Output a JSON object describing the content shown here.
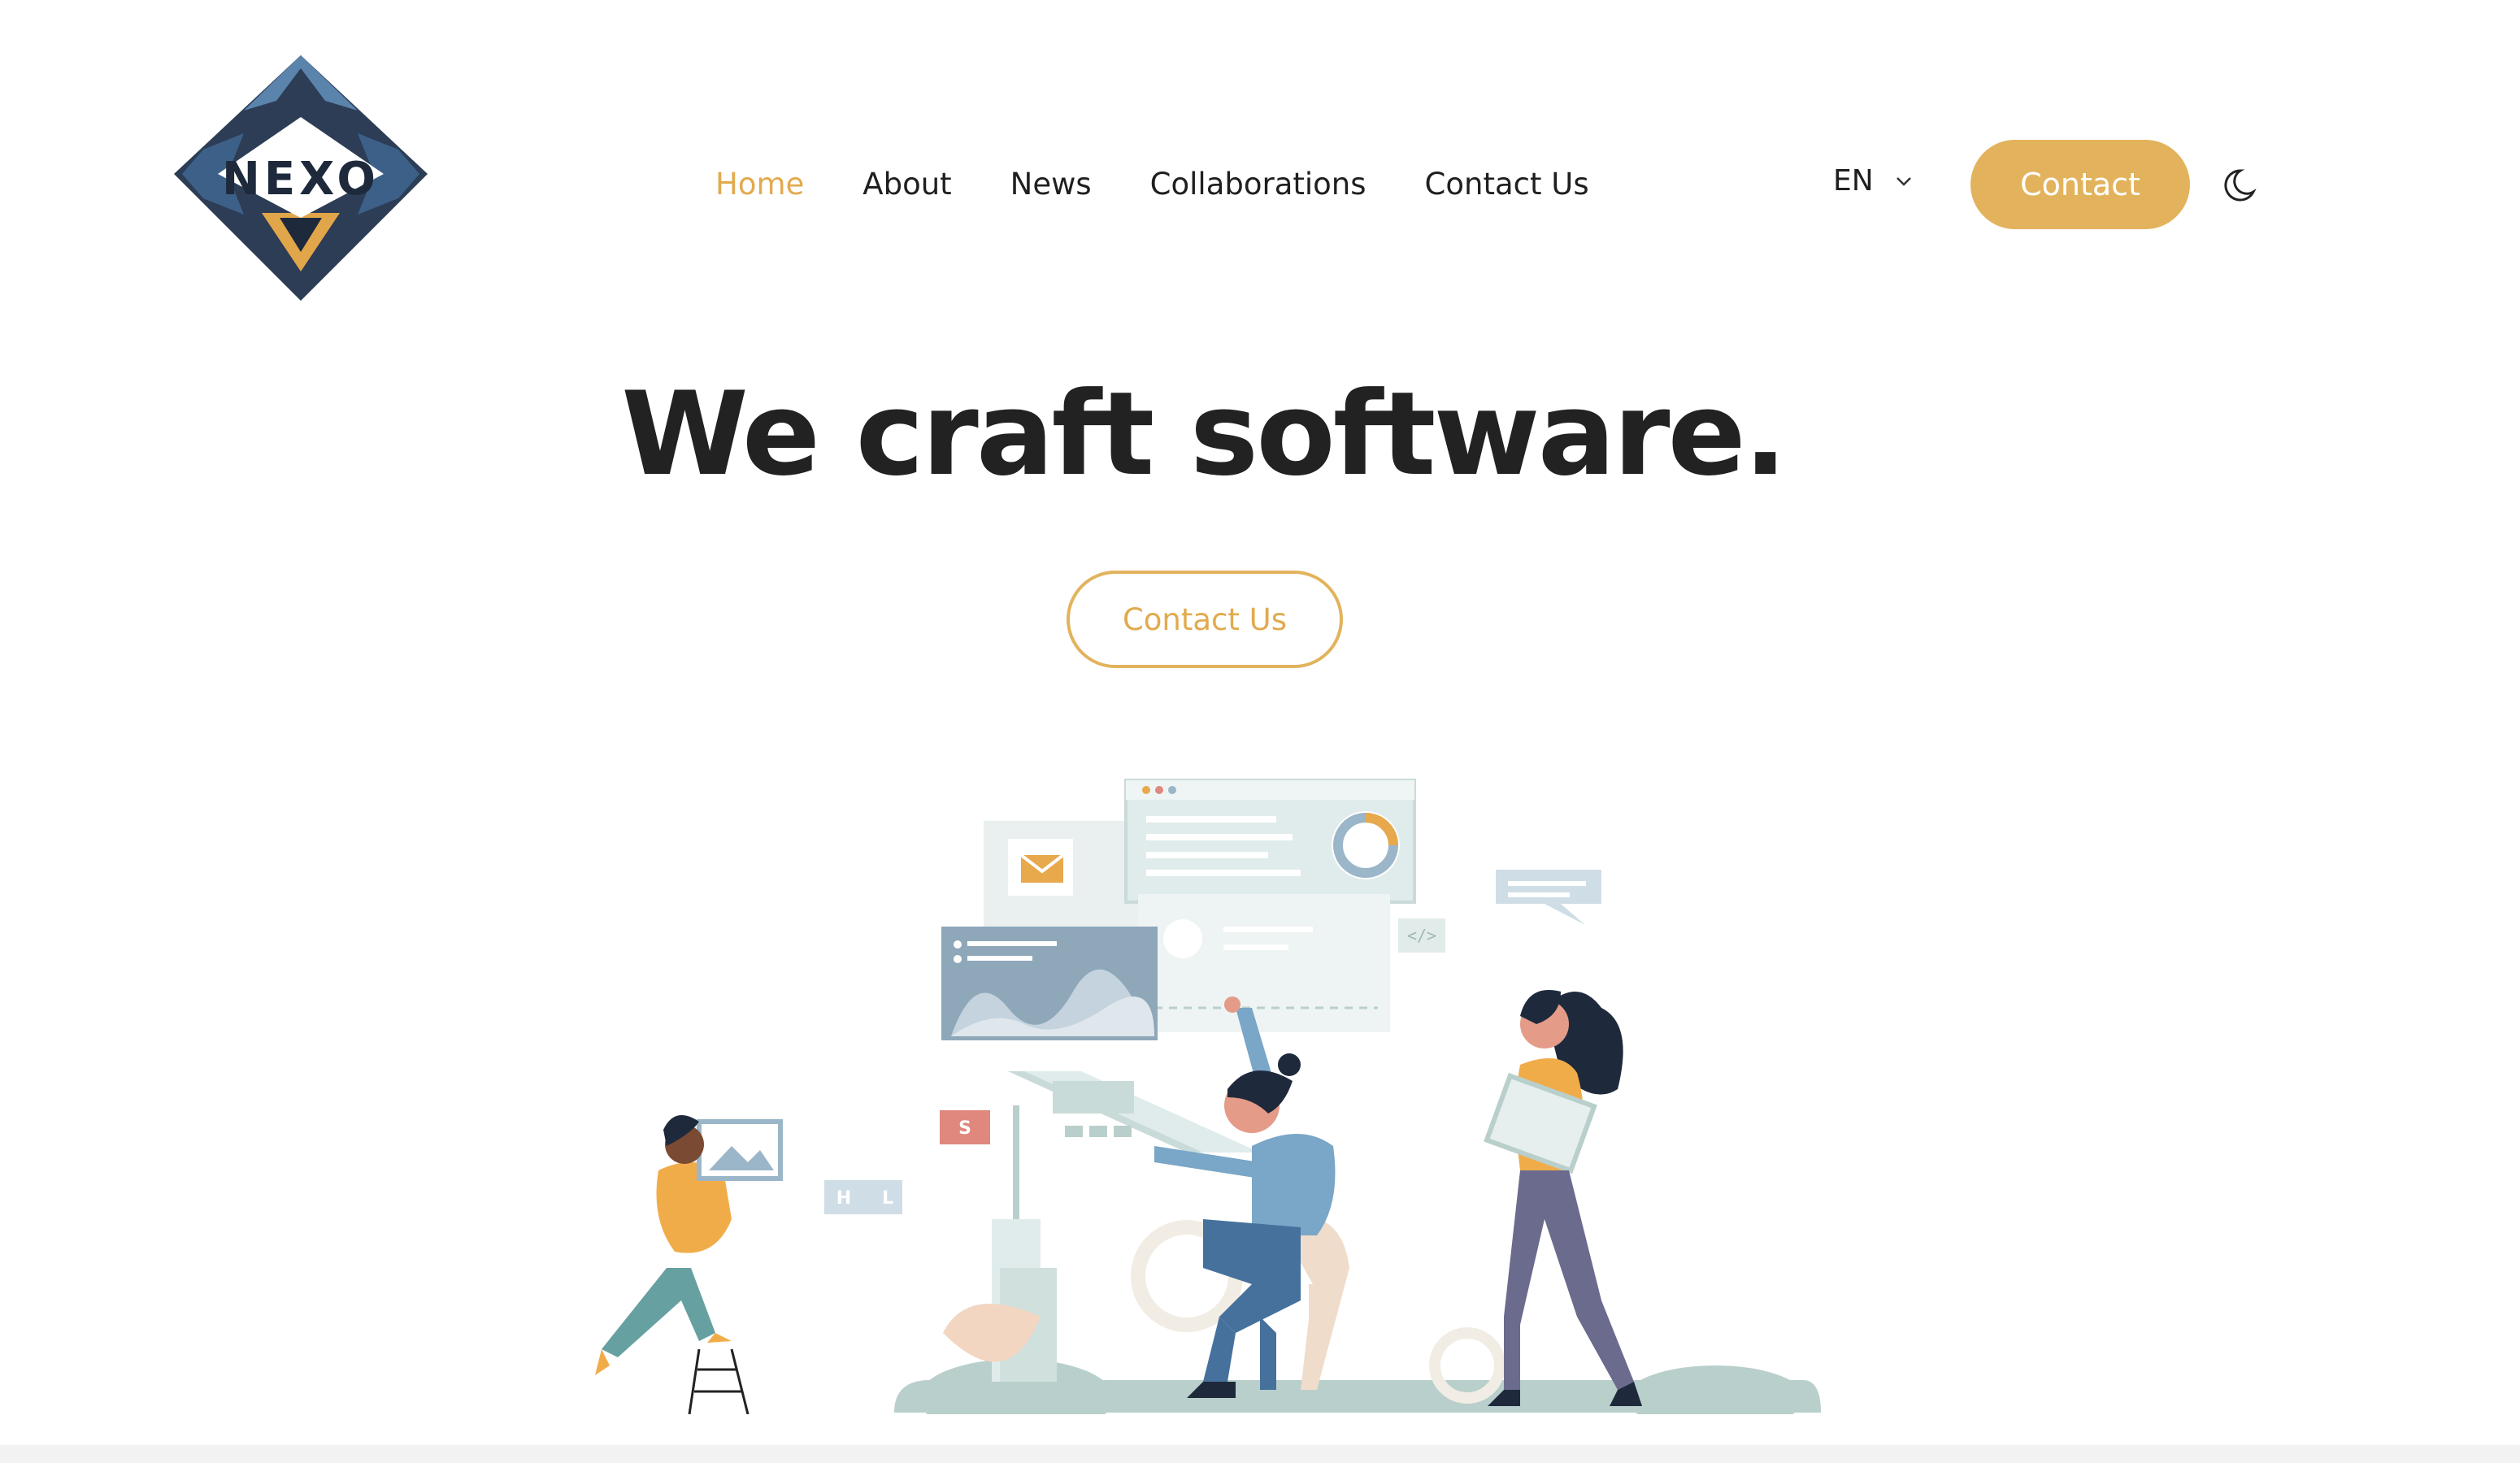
{
  "brand": {
    "logo_text": "NEXO"
  },
  "nav": {
    "items": [
      {
        "label": "Home",
        "active": true
      },
      {
        "label": "About",
        "active": false
      },
      {
        "label": "News",
        "active": false
      },
      {
        "label": "Collaborations",
        "active": false
      },
      {
        "label": "Contact Us",
        "active": false
      }
    ]
  },
  "header": {
    "language": "EN",
    "language_icon": "chevron-down-icon",
    "contact_label": "Contact",
    "theme_icon": "moon-icon"
  },
  "hero": {
    "title": "We craft software.",
    "cta_label": "Contact Us"
  },
  "illustration": {
    "letters": [
      "S",
      "H",
      "L"
    ],
    "code_tag": "</>"
  },
  "colors": {
    "accent": "#e2b35c",
    "accent_text": "#e2aa4e",
    "text": "#222222",
    "navy": "#1e2a3c",
    "sage": "#b9cfcb"
  }
}
